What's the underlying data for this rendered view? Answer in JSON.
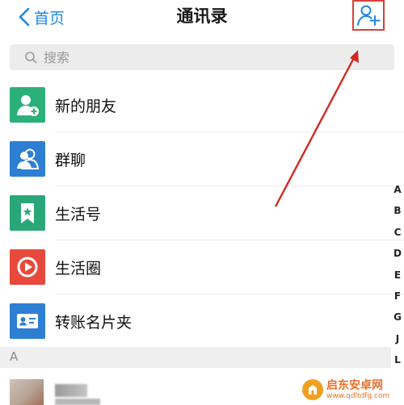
{
  "navbar": {
    "back_label": "首页",
    "title": "通讯录",
    "add_button_icon": "add-contact-icon"
  },
  "search": {
    "placeholder": "搜索"
  },
  "menu": [
    {
      "label": "新的朋友",
      "icon": "new-friend-icon",
      "color": "#2cb07a"
    },
    {
      "label": "群聊",
      "icon": "group-chat-icon",
      "color": "#2d7fd3"
    },
    {
      "label": "生活号",
      "icon": "life-account-icon",
      "color": "#2aa778"
    },
    {
      "label": "生活圈",
      "icon": "life-circle-icon",
      "color": "#e8493d"
    },
    {
      "label": "转账名片夹",
      "icon": "card-holder-icon",
      "color": "#2d7fd3"
    }
  ],
  "section_header": "A",
  "alphabet_index": [
    "A",
    "B",
    "C",
    "D",
    "E",
    "F",
    "G",
    "J",
    "L"
  ],
  "watermark": {
    "line1": "启东安卓网",
    "line2": "www.qdltdfg.com"
  },
  "colors": {
    "accent": "#1f86e5",
    "highlight": "#d7403a"
  }
}
